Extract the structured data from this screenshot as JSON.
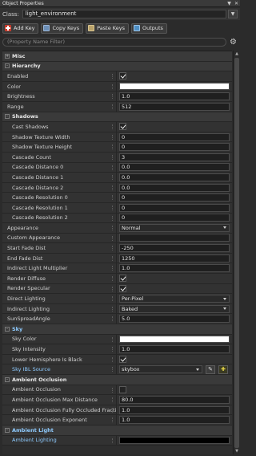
{
  "window": {
    "title": "Object Properties"
  },
  "classbar": {
    "label": "Class:",
    "value": "light_environment"
  },
  "toolbar": {
    "add_key": "Add Key",
    "copy_keys": "Copy Keys",
    "paste_keys": "Paste Keys",
    "outputs": "Outputs"
  },
  "filter": {
    "placeholder": "(Property Name Filter)"
  },
  "rows": [
    {
      "kind": "cat",
      "label": "Misc",
      "expander": "+"
    },
    {
      "kind": "cat",
      "label": "Hierarchy",
      "expander": "-"
    },
    {
      "kind": "check",
      "label": "Enabled",
      "on": true
    },
    {
      "kind": "color",
      "label": "Color",
      "color": "#ffffff"
    },
    {
      "kind": "text",
      "label": "Brightness",
      "value": "1.0"
    },
    {
      "kind": "text",
      "label": "Range",
      "value": "512"
    },
    {
      "kind": "cat",
      "label": "Shadows",
      "expander": "-"
    },
    {
      "kind": "check",
      "label": "Cast Shadows",
      "on": true,
      "sub": true
    },
    {
      "kind": "text",
      "label": "Shadow Texture Width",
      "value": "0",
      "sub": true
    },
    {
      "kind": "text",
      "label": "Shadow Texture Height",
      "value": "0",
      "sub": true
    },
    {
      "kind": "text",
      "label": "Cascade Count",
      "value": "3",
      "sub": true
    },
    {
      "kind": "text",
      "label": "Cascade Distance 0",
      "value": "0.0",
      "sub": true
    },
    {
      "kind": "text",
      "label": "Cascade Distance 1",
      "value": "0.0",
      "sub": true
    },
    {
      "kind": "text",
      "label": "Cascade Distance 2",
      "value": "0.0",
      "sub": true
    },
    {
      "kind": "text",
      "label": "Cascade Resolution 0",
      "value": "0",
      "sub": true
    },
    {
      "kind": "text",
      "label": "Cascade Resolution 1",
      "value": "0",
      "sub": true
    },
    {
      "kind": "text",
      "label": "Cascade Resolution 2",
      "value": "0",
      "sub": true
    },
    {
      "kind": "combo",
      "label": "Appearance",
      "value": "Normal"
    },
    {
      "kind": "text",
      "label": "Custom Appearance",
      "value": ""
    },
    {
      "kind": "text",
      "label": "Start Fade Dist",
      "value": "-250"
    },
    {
      "kind": "text",
      "label": "End Fade Dist",
      "value": "1250"
    },
    {
      "kind": "text",
      "label": "Indirect Light Multiplier",
      "value": "1.0"
    },
    {
      "kind": "check",
      "label": "Render Diffuse",
      "on": true
    },
    {
      "kind": "check",
      "label": "Render Specular",
      "on": true
    },
    {
      "kind": "combo",
      "label": "Direct Lighting",
      "value": "Per-Pixel"
    },
    {
      "kind": "combo",
      "label": "Indirect Lighting",
      "value": "Baked"
    },
    {
      "kind": "text",
      "label": "SunSpreadAngle",
      "value": "5.0"
    },
    {
      "kind": "cat",
      "label": "Sky",
      "expander": "-",
      "blue": true
    },
    {
      "kind": "color",
      "label": "Sky Color",
      "color": "#ffffff",
      "sub": true
    },
    {
      "kind": "text",
      "label": "Sky Intensity",
      "value": "1.0",
      "sub": true
    },
    {
      "kind": "check",
      "label": "Lower Hemisphere Is Black",
      "on": true,
      "sub": true
    },
    {
      "kind": "skyibl",
      "label": "Sky IBL Source",
      "value": "skybox",
      "sub": true,
      "blue": true
    },
    {
      "kind": "cat",
      "label": "Ambient Occlusion",
      "expander": "-"
    },
    {
      "kind": "check",
      "label": "Ambient Occlusion",
      "on": false,
      "sub": true
    },
    {
      "kind": "text",
      "label": "Ambient Occlusion Max Distance",
      "value": "80.0",
      "sub": true
    },
    {
      "kind": "text",
      "label": "Ambient Occlusion Fully Occluded Fraction",
      "value": "1.0",
      "sub": true
    },
    {
      "kind": "text",
      "label": "Ambient Occlusion Exponent",
      "value": "1.0",
      "sub": true
    },
    {
      "kind": "cat",
      "label": "Ambient Light",
      "expander": "-",
      "blue": true
    },
    {
      "kind": "color",
      "label": "Ambient Lighting",
      "color": "#000000",
      "sub": true,
      "blue": true
    }
  ],
  "colors": {
    "panel": "#2b2b2b",
    "accent_blue": "#8ecbff",
    "add_red": "#c83a2a"
  },
  "icons": [
    "add-key-icon",
    "copy-keys-icon",
    "paste-keys-icon",
    "outputs-icon",
    "gear-icon",
    "pin-icon",
    "close-icon",
    "eyedropper-icon",
    "entity-picker-icon"
  ]
}
